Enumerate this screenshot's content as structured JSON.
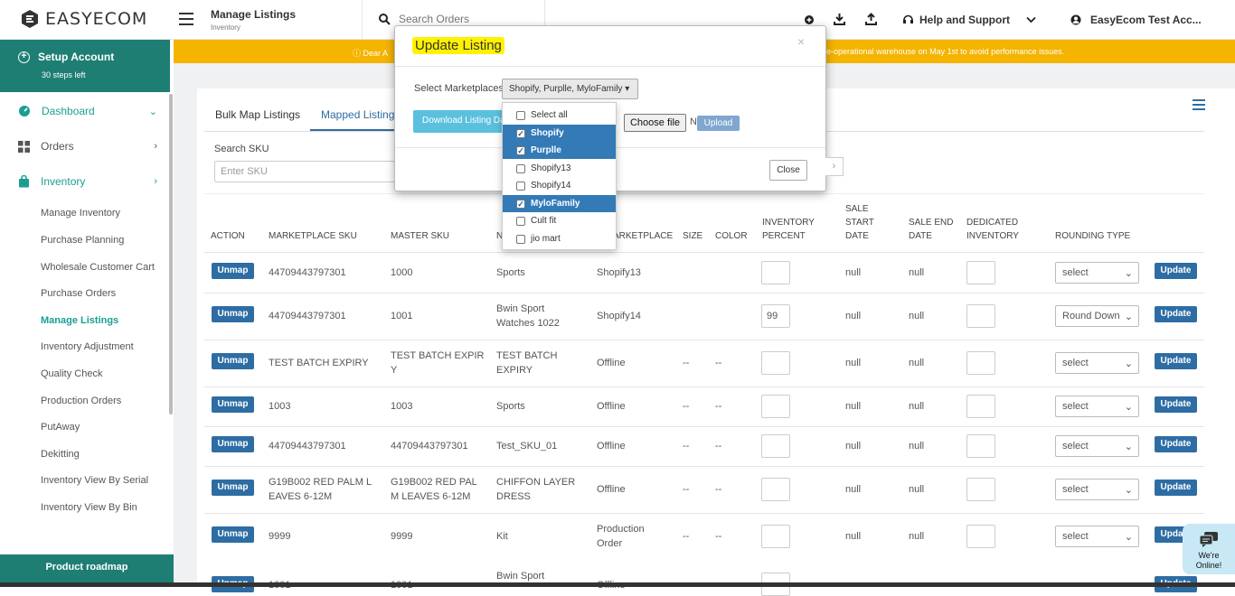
{
  "brand": {
    "name": "EASYECOM"
  },
  "header": {
    "page_title": "Manage Listings",
    "page_subtitle": "Inventory",
    "search_placeholder": "Search Orders",
    "help_label": "Help and Support",
    "user_name": "EasyEcom Test Acc..."
  },
  "sidebar": {
    "setup_title": "Setup Account",
    "setup_sub": "30 steps left",
    "nav": {
      "dashboard": "Dashboard",
      "orders": "Orders",
      "inventory": "Inventory"
    },
    "sub_items": [
      "Manage Inventory",
      "Purchase Planning",
      "Wholesale Customer Cart",
      "Purchase Orders",
      "Manage Listings",
      "Inventory Adjustment",
      "Quality Check",
      "Production Orders",
      "PutAway",
      "Dekitting",
      "Inventory View By Serial",
      "Inventory View By Bin"
    ],
    "roadmap": "Product roadmap"
  },
  "banner": {
    "left": "Dear A",
    "right": "e-operational warehouse on May 1st to avoid performance issues."
  },
  "tabs": {
    "bulk": "Bulk Map Listings",
    "mapped": "Mapped Listing"
  },
  "search_sku": {
    "label": "Search SKU",
    "placeholder": "Enter SKU"
  },
  "columns": {
    "action": "ACTION",
    "marketplace_sku": "MARKETPLACE SKU",
    "master_sku": "MASTER SKU",
    "name": "N",
    "marketplace": "ARKETPLACE",
    "size": "SIZE",
    "color": "COLOR",
    "inventory_percent": [
      "INVENTORY",
      "PERCENT"
    ],
    "sale_start": [
      "SALE",
      "START",
      "DATE"
    ],
    "sale_end": [
      "SALE END",
      "DATE"
    ],
    "dedicated": [
      "DEDICATED",
      "INVENTORY"
    ],
    "rounding": "ROUNDING TYPE"
  },
  "rows": [
    {
      "mp_sku": [
        "44709443797301"
      ],
      "master": [
        "1000"
      ],
      "name": [
        "Sports"
      ],
      "market": [
        "Shopify13"
      ],
      "size": "",
      "color": "",
      "inv": "",
      "start": "null",
      "end": "null",
      "round": "select"
    },
    {
      "mp_sku": [
        "44709443797301"
      ],
      "master": [
        "1001"
      ],
      "name": [
        "Bwin Sport",
        "Watches 1022"
      ],
      "market": [
        "Shopify14"
      ],
      "size": "",
      "color": "",
      "inv": "99",
      "start": "null",
      "end": "null",
      "round": "Round Down"
    },
    {
      "mp_sku": [
        "TEST BATCH EXPIRY"
      ],
      "master": [
        "TEST BATCH EXPIR",
        "Y"
      ],
      "name": [
        "TEST BATCH",
        "EXPIRY"
      ],
      "market": [
        "Offline"
      ],
      "size": "--",
      "color": "--",
      "inv": "",
      "start": "null",
      "end": "null",
      "round": "select"
    },
    {
      "mp_sku": [
        "1003"
      ],
      "master": [
        "1003"
      ],
      "name": [
        "Sports"
      ],
      "market": [
        "Offline"
      ],
      "size": "--",
      "color": "--",
      "inv": "",
      "start": "null",
      "end": "null",
      "round": "select"
    },
    {
      "mp_sku": [
        "44709443797301"
      ],
      "master": [
        "44709443797301"
      ],
      "name": [
        "Test_SKU_01"
      ],
      "market": [
        "Offline"
      ],
      "size": "--",
      "color": "--",
      "inv": "",
      "start": "null",
      "end": "null",
      "round": "select"
    },
    {
      "mp_sku": [
        "G19B002 RED PALM L",
        "EAVES 6-12M"
      ],
      "master": [
        "G19B002 RED PAL",
        "M LEAVES 6-12M"
      ],
      "name": [
        "CHIFFON LAYER",
        "DRESS"
      ],
      "market": [
        "Offline"
      ],
      "size": "--",
      "color": "--",
      "inv": "",
      "start": "null",
      "end": "null",
      "round": "select"
    },
    {
      "mp_sku": [
        "9999"
      ],
      "master": [
        "9999"
      ],
      "name": [
        "Kit"
      ],
      "market": [
        "Production",
        "Order"
      ],
      "size": "--",
      "color": "--",
      "inv": "",
      "start": "null",
      "end": "null",
      "round": "select"
    }
  ],
  "partial_row": {
    "mp_sku": "1001",
    "master": "1001",
    "name": "Bwin Sport",
    "market": "Offline"
  },
  "buttons": {
    "unmap": "Unmap",
    "update": "Update"
  },
  "modal": {
    "title": "Update Listing",
    "close_x": "×",
    "select_label": "Select Marketplaces",
    "select_value": "Shopify, Purplle, MyloFamily",
    "download_label": "Download Listing Da",
    "choose_file": "Choose file",
    "no_file": "N",
    "upload": "Upload",
    "close": "Close"
  },
  "dropdown": [
    {
      "label": "Select all",
      "checked": false
    },
    {
      "label": "Shopify",
      "checked": true
    },
    {
      "label": "Purplle",
      "checked": true
    },
    {
      "label": "Shopify13",
      "checked": false
    },
    {
      "label": "Shopify14",
      "checked": false
    },
    {
      "label": "MyloFamily",
      "checked": true
    },
    {
      "label": "Cult fit",
      "checked": false
    },
    {
      "label": "jio mart",
      "checked": false
    }
  ],
  "chat": {
    "line1": "We're",
    "line2": "Online!"
  },
  "colors": {
    "teal": "#1e7e74",
    "blue": "#2e6da4",
    "banner": "#f4b400",
    "highlight": "#fff200"
  }
}
